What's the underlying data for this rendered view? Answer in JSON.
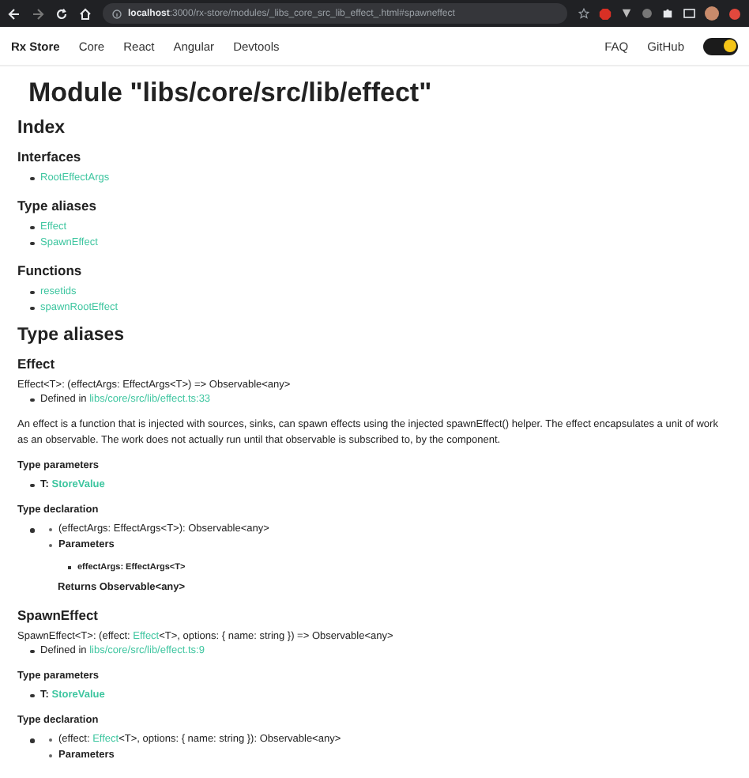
{
  "browser": {
    "url_host": "localhost",
    "url_path": ":3000/rx-store/modules/_libs_core_src_lib_effect_.html#spawneffect"
  },
  "nav": {
    "brand": "Rx Store",
    "links": [
      "Core",
      "React",
      "Angular",
      "Devtools"
    ],
    "right_links": [
      "FAQ",
      "GitHub"
    ],
    "theme_toggle": {
      "on": true
    }
  },
  "title": "Module \"libs/core/src/lib/effect\"",
  "content": [
    {
      "kind": "h2",
      "text": "Index"
    },
    {
      "kind": "h3",
      "text": "Interfaces"
    },
    {
      "kind": "links",
      "items": [
        "RootEffectArgs"
      ]
    },
    {
      "kind": "h3",
      "text": "Type aliases"
    },
    {
      "kind": "links",
      "items": [
        "Effect",
        "SpawnEffect"
      ]
    },
    {
      "kind": "h3",
      "text": "Functions"
    },
    {
      "kind": "links",
      "items": [
        "resetids",
        "spawnRootEffect"
      ]
    },
    {
      "kind": "h2",
      "text": "Type aliases"
    },
    {
      "kind": "h3",
      "text": "Effect"
    },
    {
      "kind": "signature",
      "parts": [
        {
          "text": "Effect<T>: (effectArgs: EffectArgs<T>) => Observable<any>",
          "kind": "text"
        }
      ]
    },
    {
      "kind": "defined",
      "label": "Defined in ",
      "link": "libs/core/src/lib/effect.ts:33"
    },
    {
      "kind": "paragraph",
      "text": "An effect is a function that is injected with sources, sinks, can spawn effects using the injected spawnEffect() helper. The effect encapsulates a unit of work as an observable. The work does not actually run until that observable is subscribed to, by the component."
    },
    {
      "kind": "h4",
      "text": "Type parameters"
    },
    {
      "kind": "type_param",
      "name": "T: ",
      "link": "StoreValue"
    },
    {
      "kind": "h4",
      "text": "Type declaration"
    },
    {
      "kind": "declaration",
      "signature": [
        {
          "text": "(effectArgs: EffectArgs<T>): Observable<any>",
          "kind": "text"
        }
      ],
      "parameters_label": "Parameters",
      "params": [
        "effectArgs: EffectArgs<T>"
      ],
      "returns": "Returns Observable<any>"
    },
    {
      "kind": "h3",
      "text": "SpawnEffect"
    },
    {
      "kind": "signature",
      "parts": [
        {
          "text": "SpawnEffect<T>: (effect: ",
          "kind": "text"
        },
        {
          "text": "Effect",
          "kind": "link"
        },
        {
          "text": "<T>, options: { name: string }) => Observable<any>",
          "kind": "text"
        }
      ]
    },
    {
      "kind": "defined",
      "label": "Defined in ",
      "link": "libs/core/src/lib/effect.ts:9"
    },
    {
      "kind": "h4",
      "text": "Type parameters"
    },
    {
      "kind": "type_param",
      "name": "T: ",
      "link": "StoreValue"
    },
    {
      "kind": "h4",
      "text": "Type declaration"
    },
    {
      "kind": "declaration",
      "signature": [
        {
          "text": "(effect: ",
          "kind": "text"
        },
        {
          "text": "Effect",
          "kind": "link"
        },
        {
          "text": "<T>, options: { name: string }): Observable<any>",
          "kind": "text"
        }
      ],
      "parameters_label": "Parameters"
    }
  ]
}
